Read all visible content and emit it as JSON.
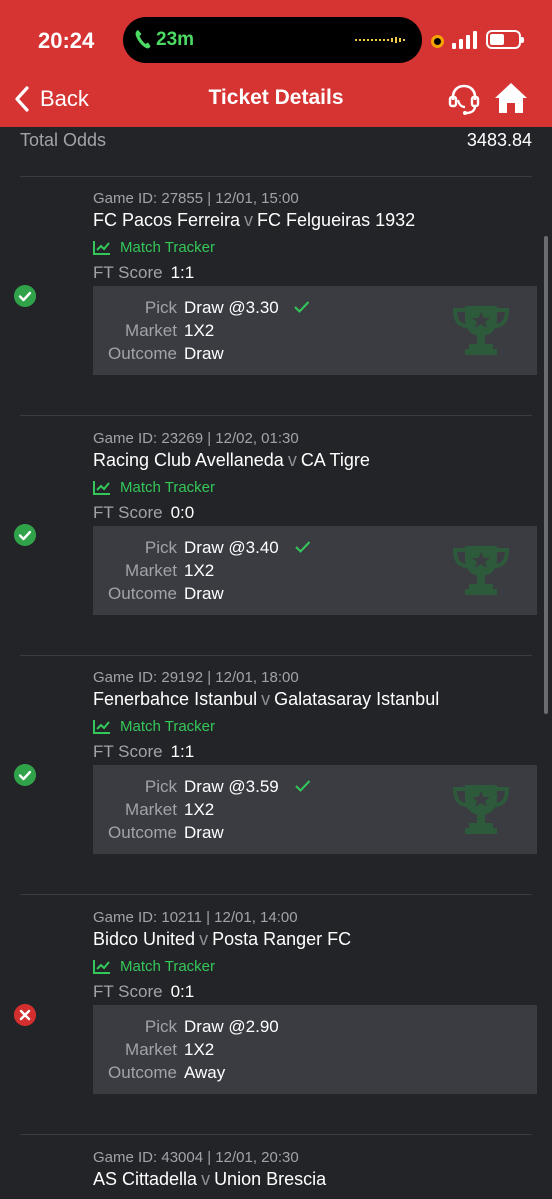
{
  "status_bar": {
    "time": "20:24",
    "call_time": "23m"
  },
  "header": {
    "back_label": "Back",
    "title": "Ticket Details"
  },
  "summary": {
    "total_odds_label": "Total Odds",
    "total_odds_value": "3483.84"
  },
  "labels": {
    "match_tracker": "Match Tracker",
    "ft_score": "FT Score",
    "pick": "Pick",
    "market": "Market",
    "outcome": "Outcome",
    "versus": "v"
  },
  "colors": {
    "brand_red": "#d63333",
    "win_green": "#2fa24a",
    "loss_red": "#d32f2f",
    "tracker_green": "#34c759"
  },
  "games": [
    {
      "status": "won",
      "game_id": "Game ID: 27855 | 12/01, 15:00",
      "home": "FC Pacos Ferreira",
      "away": "FC Felgueiras 1932",
      "ft_score": "1:1",
      "pick": "Draw @3.30",
      "pick_correct": true,
      "market": "1X2",
      "outcome": "Draw"
    },
    {
      "status": "won",
      "game_id": "Game ID: 23269 | 12/02, 01:30",
      "home": "Racing Club Avellaneda",
      "away": "CA Tigre",
      "ft_score": "0:0",
      "pick": "Draw @3.40",
      "pick_correct": true,
      "market": "1X2",
      "outcome": "Draw"
    },
    {
      "status": "won",
      "game_id": "Game ID: 29192 | 12/01, 18:00",
      "home": "Fenerbahce Istanbul",
      "away": "Galatasaray Istanbul",
      "ft_score": "1:1",
      "pick": "Draw @3.59",
      "pick_correct": true,
      "market": "1X2",
      "outcome": "Draw"
    },
    {
      "status": "lost",
      "game_id": "Game ID: 10211 | 12/01, 14:00",
      "home": "Bidco United",
      "away": "Posta Ranger FC",
      "ft_score": "0:1",
      "pick": "Draw @2.90",
      "pick_correct": false,
      "market": "1X2",
      "outcome": "Away"
    },
    {
      "status": "pending",
      "game_id": "Game ID: 43004 | 12/01, 20:30",
      "home": "AS Cittadella",
      "away": "Union Brescia"
    }
  ]
}
